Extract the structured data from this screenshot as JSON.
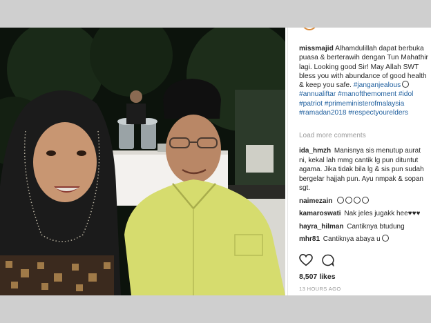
{
  "post": {
    "username": "missmajid",
    "caption": "Alhamdulillah dapat berbuka puasa & berterawih dengan Tun Mahathir lagi. Looking good Sir! May Allah SWT bless you with abundance of good health & keep you safe.",
    "caption_tag": "#janganjealous",
    "hashtags_line1": "#annualiftar #manofthemoment #idol",
    "hashtags_line2": "#patriot #primeministerofmalaysia",
    "hashtags_line3": "#ramadan2018 #respectyourelders"
  },
  "load_more_label": "Load more comments",
  "comments": [
    {
      "user": "ida_hmzh",
      "text": "Manisnya sis menutup aurat ni, kekal lah mmg cantik lg pun dituntut agama. Jika tidak bila lg & sis pun sudah bergelar hajjah pun. Ayu nmpak & sopan sgt."
    },
    {
      "user": "naimezain",
      "text": ""
    },
    {
      "user": "kamaroswati",
      "text": "Nak jeles jugakk hee♥♥♥"
    },
    {
      "user": "hayra_hilman",
      "text": "Cantiknya btudung"
    },
    {
      "user": "mhr81",
      "text": "Cantiknya abaya u"
    }
  ],
  "likes": "8,507 likes",
  "timestamp": "13 HOURS AGO",
  "icons": {
    "like": "heart-icon",
    "comment": "comment-icon",
    "emoji": "face-emoji-icon"
  },
  "colors": {
    "hashtag": "#1f5f9e",
    "text": "#262626",
    "muted": "#999999",
    "shirt": "#d6dc6e",
    "hijab": "#1b1b1b"
  }
}
